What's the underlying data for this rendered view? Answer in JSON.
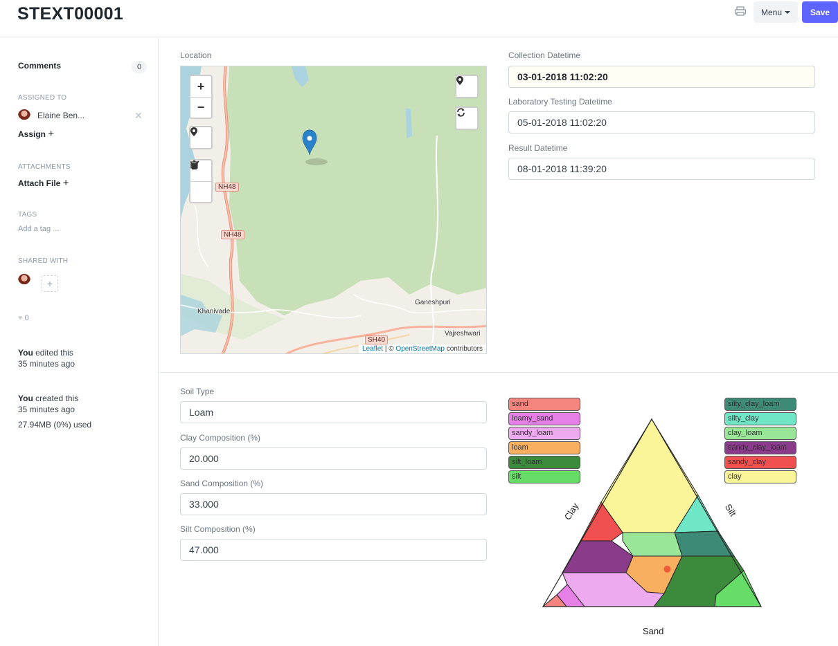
{
  "header": {
    "title": "STEXT00001",
    "menu_label": "Menu",
    "save_label": "Save"
  },
  "sidebar": {
    "comments_label": "Comments",
    "comments_count": "0",
    "assigned_to_label": "ASSIGNED TO",
    "assignee_name": "Elaine Ben...",
    "assign_label": "Assign",
    "attachments_label": "ATTACHMENTS",
    "attach_label": "Attach File",
    "tags_label": "TAGS",
    "tag_placeholder": "Add a tag ...",
    "shared_with_label": "SHARED WITH",
    "likes_count": "0",
    "edited_actor": "You",
    "edited_text": "edited this",
    "edited_time": "35 minutes ago",
    "created_actor": "You",
    "created_text": "created this",
    "created_time": "35 minutes ago",
    "storage_used": "27.94MB (0%) used"
  },
  "location": {
    "label": "Location",
    "road_labels": [
      "NH48",
      "NH48",
      "SH40"
    ],
    "places": [
      "Ganeshpuri",
      "Khanivade",
      "Vajreshwari"
    ],
    "attribution_leaflet": "Leaflet",
    "attribution_sep": " | © ",
    "attribution_osm": "OpenStreetMap",
    "attribution_rest": " contributors"
  },
  "datetimes": {
    "collection_label": "Collection Datetime",
    "collection_value": "03-01-2018 11:02:20",
    "lab_label": "Laboratory Testing Datetime",
    "lab_value": "05-01-2018 11:02:20",
    "result_label": "Result Datetime",
    "result_value": "08-01-2018 11:39:20"
  },
  "soil": {
    "type_label": "Soil Type",
    "type_value": "Loam",
    "clay_label": "Clay Composition (%)",
    "clay_value": "20.000",
    "sand_label": "Sand Composition (%)",
    "sand_value": "33.000",
    "silt_label": "Silt Composition (%)",
    "silt_value": "47.000"
  },
  "ternary": {
    "axis_clay": "Clay",
    "axis_silt": "Silt",
    "axis_sand": "Sand",
    "legend_left": [
      {
        "name": "sand",
        "color": "#f4847e"
      },
      {
        "name": "loamy_sand",
        "color": "#e67fe6"
      },
      {
        "name": "sandy_loam",
        "color": "#eeaaee"
      },
      {
        "name": "loam",
        "color": "#f8b060"
      },
      {
        "name": "silt_loam",
        "color": "#3c8a3c"
      },
      {
        "name": "silt",
        "color": "#66dd66"
      }
    ],
    "legend_right": [
      {
        "name": "silty_clay_loam",
        "color": "#3d8a76"
      },
      {
        "name": "silty_clay",
        "color": "#6fe6c6"
      },
      {
        "name": "clay_loam",
        "color": "#99e699"
      },
      {
        "name": "sandy_clay_loam",
        "color": "#8a3c8a"
      },
      {
        "name": "sandy_clay",
        "color": "#f05050"
      },
      {
        "name": "clay",
        "color": "#fbf59a"
      }
    ],
    "point": {
      "clay": 20,
      "sand": 33,
      "silt": 47,
      "color": "#f25a3c"
    }
  }
}
